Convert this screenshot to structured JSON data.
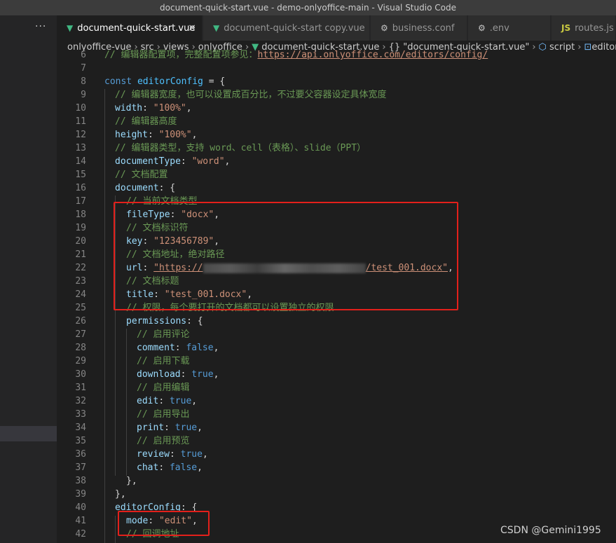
{
  "window": {
    "title": "document-quick-start.vue - demo-onlyoffice-main - Visual Studio Code"
  },
  "sidebar": {
    "more_label": "···"
  },
  "tabs": [
    {
      "label": "document-quick-start.vue",
      "icon": "vue-icon",
      "active": true,
      "close": "×"
    },
    {
      "label": "document-quick-start copy.vue",
      "icon": "vue-icon",
      "active": false
    },
    {
      "label": "business.conf",
      "icon": "gear-icon",
      "active": false
    },
    {
      "label": ".env",
      "icon": "gear-icon",
      "active": false
    },
    {
      "label": "routes.js",
      "icon": "js-icon",
      "active": false
    }
  ],
  "breadcrumb": [
    "onlyoffice-vue",
    "src",
    "views",
    "onlyoffice",
    "document-quick-start.vue",
    "{} \"document-quick-start.vue\"",
    "script",
    "editorConfig"
  ],
  "editor": {
    "line_numbers": [
      "6",
      "7",
      "8",
      "9",
      "10",
      "11",
      "12",
      "13",
      "14",
      "15",
      "16",
      "17",
      "18",
      "19",
      "20",
      "21",
      "22",
      "23",
      "24",
      "25",
      "26",
      "27",
      "28",
      "29",
      "30",
      "31",
      "32",
      "33",
      "34",
      "35",
      "36",
      "37",
      "38",
      "39",
      "40",
      "41",
      "42"
    ],
    "line6_comment": "// 编辑器配置项，完整配置项参见：",
    "line6_url": "https://api.onlyoffice.com/editors/config/",
    "c9": "// 编辑器宽度，也可以设置成百分比，不过要父容器设定具体宽度",
    "width_val": "\"100%\"",
    "c11": "// 编辑器高度",
    "height_val": "\"100%\"",
    "c13": "// 编辑器类型，支持 word、cell（表格）、slide（PPT）",
    "doctype_val": "\"word\"",
    "c15": "// 文档配置",
    "c17": "// 当前文档类型",
    "filetype_val": "\"docx\"",
    "c19": "// 文档标识符",
    "key_val": "\"123456789\"",
    "c21": "// 文档地址，绝对路径",
    "url_prefix": "\"https://",
    "url_suffix": "/test_001.docx\"",
    "c23": "// 文档标题",
    "title_val": "\"test_001.docx\"",
    "c25": "// 权限，每个要打开的文档都可以设置独立的权限",
    "c27": "// 启用评论",
    "c29": "// 启用下载",
    "c31": "// 启用编辑",
    "c33": "// 启用导出",
    "c35": "// 启用预览",
    "c42": "// 回调地址",
    "mode_val": "\"edit\""
  },
  "watermark": "CSDN @Gemini1995"
}
